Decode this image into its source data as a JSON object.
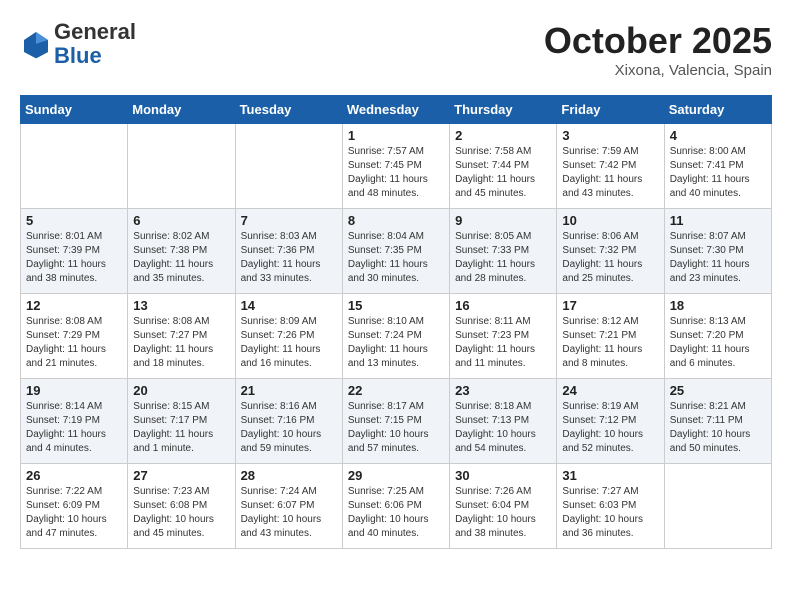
{
  "header": {
    "logo_general": "General",
    "logo_blue": "Blue",
    "month": "October 2025",
    "location": "Xixona, Valencia, Spain"
  },
  "weekdays": [
    "Sunday",
    "Monday",
    "Tuesday",
    "Wednesday",
    "Thursday",
    "Friday",
    "Saturday"
  ],
  "weeks": [
    [
      {
        "day": "",
        "info": ""
      },
      {
        "day": "",
        "info": ""
      },
      {
        "day": "",
        "info": ""
      },
      {
        "day": "1",
        "info": "Sunrise: 7:57 AM\nSunset: 7:45 PM\nDaylight: 11 hours\nand 48 minutes."
      },
      {
        "day": "2",
        "info": "Sunrise: 7:58 AM\nSunset: 7:44 PM\nDaylight: 11 hours\nand 45 minutes."
      },
      {
        "day": "3",
        "info": "Sunrise: 7:59 AM\nSunset: 7:42 PM\nDaylight: 11 hours\nand 43 minutes."
      },
      {
        "day": "4",
        "info": "Sunrise: 8:00 AM\nSunset: 7:41 PM\nDaylight: 11 hours\nand 40 minutes."
      }
    ],
    [
      {
        "day": "5",
        "info": "Sunrise: 8:01 AM\nSunset: 7:39 PM\nDaylight: 11 hours\nand 38 minutes."
      },
      {
        "day": "6",
        "info": "Sunrise: 8:02 AM\nSunset: 7:38 PM\nDaylight: 11 hours\nand 35 minutes."
      },
      {
        "day": "7",
        "info": "Sunrise: 8:03 AM\nSunset: 7:36 PM\nDaylight: 11 hours\nand 33 minutes."
      },
      {
        "day": "8",
        "info": "Sunrise: 8:04 AM\nSunset: 7:35 PM\nDaylight: 11 hours\nand 30 minutes."
      },
      {
        "day": "9",
        "info": "Sunrise: 8:05 AM\nSunset: 7:33 PM\nDaylight: 11 hours\nand 28 minutes."
      },
      {
        "day": "10",
        "info": "Sunrise: 8:06 AM\nSunset: 7:32 PM\nDaylight: 11 hours\nand 25 minutes."
      },
      {
        "day": "11",
        "info": "Sunrise: 8:07 AM\nSunset: 7:30 PM\nDaylight: 11 hours\nand 23 minutes."
      }
    ],
    [
      {
        "day": "12",
        "info": "Sunrise: 8:08 AM\nSunset: 7:29 PM\nDaylight: 11 hours\nand 21 minutes."
      },
      {
        "day": "13",
        "info": "Sunrise: 8:08 AM\nSunset: 7:27 PM\nDaylight: 11 hours\nand 18 minutes."
      },
      {
        "day": "14",
        "info": "Sunrise: 8:09 AM\nSunset: 7:26 PM\nDaylight: 11 hours\nand 16 minutes."
      },
      {
        "day": "15",
        "info": "Sunrise: 8:10 AM\nSunset: 7:24 PM\nDaylight: 11 hours\nand 13 minutes."
      },
      {
        "day": "16",
        "info": "Sunrise: 8:11 AM\nSunset: 7:23 PM\nDaylight: 11 hours\nand 11 minutes."
      },
      {
        "day": "17",
        "info": "Sunrise: 8:12 AM\nSunset: 7:21 PM\nDaylight: 11 hours\nand 8 minutes."
      },
      {
        "day": "18",
        "info": "Sunrise: 8:13 AM\nSunset: 7:20 PM\nDaylight: 11 hours\nand 6 minutes."
      }
    ],
    [
      {
        "day": "19",
        "info": "Sunrise: 8:14 AM\nSunset: 7:19 PM\nDaylight: 11 hours\nand 4 minutes."
      },
      {
        "day": "20",
        "info": "Sunrise: 8:15 AM\nSunset: 7:17 PM\nDaylight: 11 hours\nand 1 minute."
      },
      {
        "day": "21",
        "info": "Sunrise: 8:16 AM\nSunset: 7:16 PM\nDaylight: 10 hours\nand 59 minutes."
      },
      {
        "day": "22",
        "info": "Sunrise: 8:17 AM\nSunset: 7:15 PM\nDaylight: 10 hours\nand 57 minutes."
      },
      {
        "day": "23",
        "info": "Sunrise: 8:18 AM\nSunset: 7:13 PM\nDaylight: 10 hours\nand 54 minutes."
      },
      {
        "day": "24",
        "info": "Sunrise: 8:19 AM\nSunset: 7:12 PM\nDaylight: 10 hours\nand 52 minutes."
      },
      {
        "day": "25",
        "info": "Sunrise: 8:21 AM\nSunset: 7:11 PM\nDaylight: 10 hours\nand 50 minutes."
      }
    ],
    [
      {
        "day": "26",
        "info": "Sunrise: 7:22 AM\nSunset: 6:09 PM\nDaylight: 10 hours\nand 47 minutes."
      },
      {
        "day": "27",
        "info": "Sunrise: 7:23 AM\nSunset: 6:08 PM\nDaylight: 10 hours\nand 45 minutes."
      },
      {
        "day": "28",
        "info": "Sunrise: 7:24 AM\nSunset: 6:07 PM\nDaylight: 10 hours\nand 43 minutes."
      },
      {
        "day": "29",
        "info": "Sunrise: 7:25 AM\nSunset: 6:06 PM\nDaylight: 10 hours\nand 40 minutes."
      },
      {
        "day": "30",
        "info": "Sunrise: 7:26 AM\nSunset: 6:04 PM\nDaylight: 10 hours\nand 38 minutes."
      },
      {
        "day": "31",
        "info": "Sunrise: 7:27 AM\nSunset: 6:03 PM\nDaylight: 10 hours\nand 36 minutes."
      },
      {
        "day": "",
        "info": ""
      }
    ]
  ]
}
